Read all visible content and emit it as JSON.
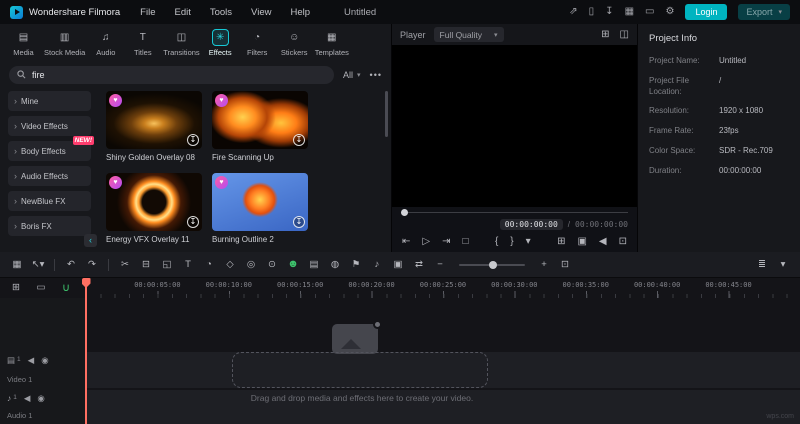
{
  "accent": "#17c9d6",
  "glyphs": {
    "caret": "▾",
    "chevron": "›",
    "heart": "♥",
    "download": "↧"
  },
  "titlebar": {
    "app_name": "Wondershare Filmora",
    "menus": [
      {
        "label": "File",
        "name": "menu-file"
      },
      {
        "label": "Edit",
        "name": "menu-edit"
      },
      {
        "label": "Tools",
        "name": "menu-tools"
      },
      {
        "label": "View",
        "name": "menu-view"
      },
      {
        "label": "Help",
        "name": "menu-help"
      }
    ],
    "document_title": "Untitled",
    "right_icons": [
      {
        "glyph": "⇗",
        "name": "share-icon"
      },
      {
        "glyph": "▯",
        "name": "device-icon"
      },
      {
        "glyph": "↧",
        "name": "download-manager-icon"
      },
      {
        "glyph": "▦",
        "name": "workspace-layout-icon"
      },
      {
        "glyph": "▭",
        "name": "screen-record-icon"
      },
      {
        "glyph": "⚙",
        "name": "settings-icon"
      }
    ],
    "login_label": "Login",
    "export_label": "Export"
  },
  "media_tabs": [
    {
      "label": "Media",
      "glyph": "▤",
      "name": "tab-media",
      "icon": "media-icon"
    },
    {
      "label": "Stock Media",
      "glyph": "▥",
      "name": "tab-stock-media",
      "icon": "stock-media-icon"
    },
    {
      "label": "Audio",
      "glyph": "♫",
      "name": "tab-audio",
      "icon": "audio-icon"
    },
    {
      "label": "Titles",
      "glyph": "T",
      "name": "tab-titles",
      "icon": "titles-icon"
    },
    {
      "label": "Transitions",
      "glyph": "◫",
      "name": "tab-transitions",
      "icon": "transitions-icon"
    },
    {
      "label": "Effects",
      "glyph": "✳",
      "name": "tab-effects",
      "icon": "effects-icon",
      "active": true
    },
    {
      "label": "Filters",
      "glyph": "◔",
      "name": "tab-filters",
      "icon": "filters-icon"
    },
    {
      "label": "Stickers",
      "glyph": "☺",
      "name": "tab-stickers",
      "icon": "stickers-icon"
    },
    {
      "label": "Templates",
      "glyph": "▦",
      "name": "tab-templates",
      "icon": "templates-icon"
    }
  ],
  "search": {
    "value": "fire",
    "filter_label": "All",
    "more_label": "•••"
  },
  "categories": [
    {
      "label": "Mine",
      "name": "sidebar-item-mine"
    },
    {
      "label": "Video Effects",
      "name": "sidebar-item-video-effects"
    },
    {
      "label": "Body Effects",
      "name": "sidebar-item-body-effects",
      "badge": "NEW!"
    },
    {
      "label": "Audio Effects",
      "name": "sidebar-item-audio-effects"
    },
    {
      "label": "NewBlue FX",
      "name": "sidebar-item-newblue-fx"
    },
    {
      "label": "Boris FX",
      "name": "sidebar-item-boris-fx"
    }
  ],
  "effects": [
    {
      "name": "Shiny Golden Overlay 08",
      "thumb": "thumb-gold"
    },
    {
      "name": "Fire Scanning Up",
      "thumb": "thumb-flames"
    },
    {
      "name": "Energy VFX Overlay 11",
      "thumb": "thumb-ring"
    },
    {
      "name": "Burning Outline 2",
      "thumb": "thumb-dancer"
    }
  ],
  "player": {
    "title": "Player",
    "quality": "Full Quality",
    "current_time": "00:00:00:00",
    "separator": "/",
    "total_time": "00:00:00:00",
    "header_icons": [
      {
        "glyph": "⊞",
        "name": "grid-overlay-icon"
      },
      {
        "glyph": "◫",
        "name": "aspect-ratio-icon"
      }
    ],
    "controls_left": [
      {
        "glyph": "⇤",
        "name": "previous-frame-icon"
      },
      {
        "glyph": "▷",
        "name": "play-icon"
      },
      {
        "glyph": "⇥",
        "name": "next-frame-icon"
      },
      {
        "glyph": "□",
        "name": "stop-icon"
      }
    ],
    "controls_mid": [
      {
        "glyph": "{",
        "name": "mark-in-icon"
      },
      {
        "glyph": "}",
        "name": "mark-out-icon"
      },
      {
        "glyph": "▾",
        "name": "render-preview-icon"
      }
    ],
    "controls_right": [
      {
        "glyph": "⊞",
        "name": "snapshot-icon"
      },
      {
        "glyph": "▣",
        "name": "camera-icon"
      },
      {
        "glyph": "◀",
        "name": "volume-icon"
      },
      {
        "glyph": "⊡",
        "name": "fullscreen-icon"
      }
    ]
  },
  "project_info": {
    "title": "Project Info",
    "fields": [
      {
        "label": "Project Name:",
        "value": "Untitled"
      },
      {
        "label": "Project File Location:",
        "value": "/"
      },
      {
        "label": "Resolution:",
        "value": "1920 x 1080"
      },
      {
        "label": "Frame Rate:",
        "value": "23fps"
      },
      {
        "label": "Color Space:",
        "value": "SDR - Rec.709"
      },
      {
        "label": "Duration:",
        "value": "00:00:00:00"
      }
    ]
  },
  "timeline": {
    "toolbar": [
      {
        "glyph": "▦",
        "name": "toolbox-icon"
      },
      {
        "glyph": "↖▾",
        "name": "select-tool-icon"
      },
      {
        "divider": true,
        "name": "toolbar-divider"
      },
      {
        "glyph": "↶",
        "name": "undo-icon"
      },
      {
        "glyph": "↷",
        "name": "redo-icon"
      },
      {
        "divider": true,
        "name": "toolbar-divider"
      },
      {
        "glyph": "✂",
        "name": "split-icon"
      },
      {
        "glyph": "⊟",
        "name": "delete-icon"
      },
      {
        "glyph": "◱",
        "name": "crop-icon"
      },
      {
        "glyph": "T",
        "name": "text-tool-icon"
      },
      {
        "glyph": "◔",
        "name": "speed-icon"
      },
      {
        "glyph": "◇",
        "name": "keyframe-icon"
      },
      {
        "glyph": "◎",
        "name": "chroma-key-icon"
      },
      {
        "glyph": "⊙",
        "name": "motion-track-icon"
      },
      {
        "glyph": "☻",
        "name": "ai-portrait-icon",
        "green": true
      },
      {
        "glyph": "▤",
        "name": "adjust-icon"
      },
      {
        "glyph": "◍",
        "name": "mask-icon"
      },
      {
        "glyph": "⚑",
        "name": "marker-icon"
      },
      {
        "glyph": "♪",
        "name": "voiceover-icon"
      },
      {
        "glyph": "▣",
        "name": "record-icon"
      },
      {
        "glyph": "⇄",
        "name": "ripple-edit-icon"
      }
    ],
    "zoom": {
      "out": "−",
      "in": "+",
      "fit": "⊡"
    },
    "toolbar_right": [
      {
        "glyph": "≣",
        "name": "track-manager-icon"
      },
      {
        "glyph": "▾",
        "name": "collapse-timeline-icon"
      }
    ],
    "ruler_head": [
      {
        "glyph": "⊞",
        "name": "manage-tracks-icon"
      },
      {
        "glyph": "▭",
        "name": "film-roll-icon"
      },
      {
        "glyph": "∪",
        "name": "snap-magnet-icon",
        "green": true
      }
    ],
    "ruler": [
      "00:00:05:00",
      "00:00:10:00",
      "00:00:15:00",
      "00:00:20:00",
      "00:00:25:00",
      "00:00:30:00",
      "00:00:35:00",
      "00:00:40:00",
      "00:00:45:00"
    ],
    "video_icons": [
      {
        "glyph": "▤",
        "name": "video-track-icon"
      },
      {
        "glyph": "1",
        "name": "video-track-number",
        "num": true
      },
      {
        "glyph": "◀",
        "name": "mute-track-icon"
      },
      {
        "glyph": "◉",
        "name": "toggle-visibility-icon"
      }
    ],
    "audio_icons": [
      {
        "glyph": "♪",
        "name": "audio-track-icon"
      },
      {
        "glyph": "1",
        "name": "audio-track-number",
        "num": true
      },
      {
        "glyph": "◀",
        "name": "mute-track-icon"
      },
      {
        "glyph": "◉",
        "name": "toggle-visibility-icon"
      }
    ],
    "tracks": {
      "video": {
        "label": "Video 1"
      },
      "audio": {
        "label": "Audio 1"
      }
    },
    "placeholder": "Drag and drop media and effects here to create your video."
  },
  "watermark": "wps.com"
}
